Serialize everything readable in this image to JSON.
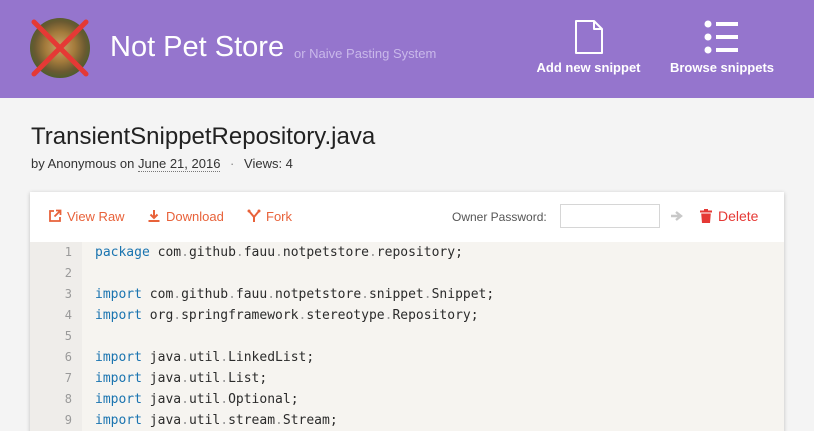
{
  "header": {
    "title": "Not Pet Store",
    "subtitle": "or Naive Pasting System",
    "add_label": "Add new snippet",
    "browse_label": "Browse snippets",
    "color": "#9575cd"
  },
  "snippet": {
    "title": "TransientSnippetRepository.java",
    "by_prefix": "by",
    "author": "Anonymous",
    "on_word": "on",
    "date": "June 21, 2016",
    "separator": "·",
    "views": "Views: 4"
  },
  "toolbar": {
    "view_raw": "View Raw",
    "download": "Download",
    "fork": "Fork",
    "owner_password_label": "Owner Password:",
    "password_value": "",
    "delete": "Delete",
    "accent": "#e8623a",
    "delete_color": "#e53935"
  },
  "code": {
    "lines": [
      {
        "n": "1",
        "kw": "package",
        "rest": "com.github.fauu.notpetstore.repository;"
      },
      {
        "n": "2",
        "kw": "",
        "rest": ""
      },
      {
        "n": "3",
        "kw": "import",
        "rest": "com.github.fauu.notpetstore.snippet.Snippet;"
      },
      {
        "n": "4",
        "kw": "import",
        "rest": "org.springframework.stereotype.Repository;"
      },
      {
        "n": "5",
        "kw": "",
        "rest": ""
      },
      {
        "n": "6",
        "kw": "import",
        "rest": "java.util.LinkedList;"
      },
      {
        "n": "7",
        "kw": "import",
        "rest": "java.util.List;"
      },
      {
        "n": "8",
        "kw": "import",
        "rest": "java.util.Optional;"
      },
      {
        "n": "9",
        "kw": "import",
        "rest": "java.util.stream.Stream;"
      }
    ]
  },
  "icons": {
    "logo": "crossed-out-dog-avatar",
    "add": "document-icon",
    "browse": "list-icon",
    "view_raw": "external-link-icon",
    "download": "download-icon",
    "fork": "fork-icon",
    "submit": "arrow-right-icon",
    "delete": "trash-icon"
  }
}
